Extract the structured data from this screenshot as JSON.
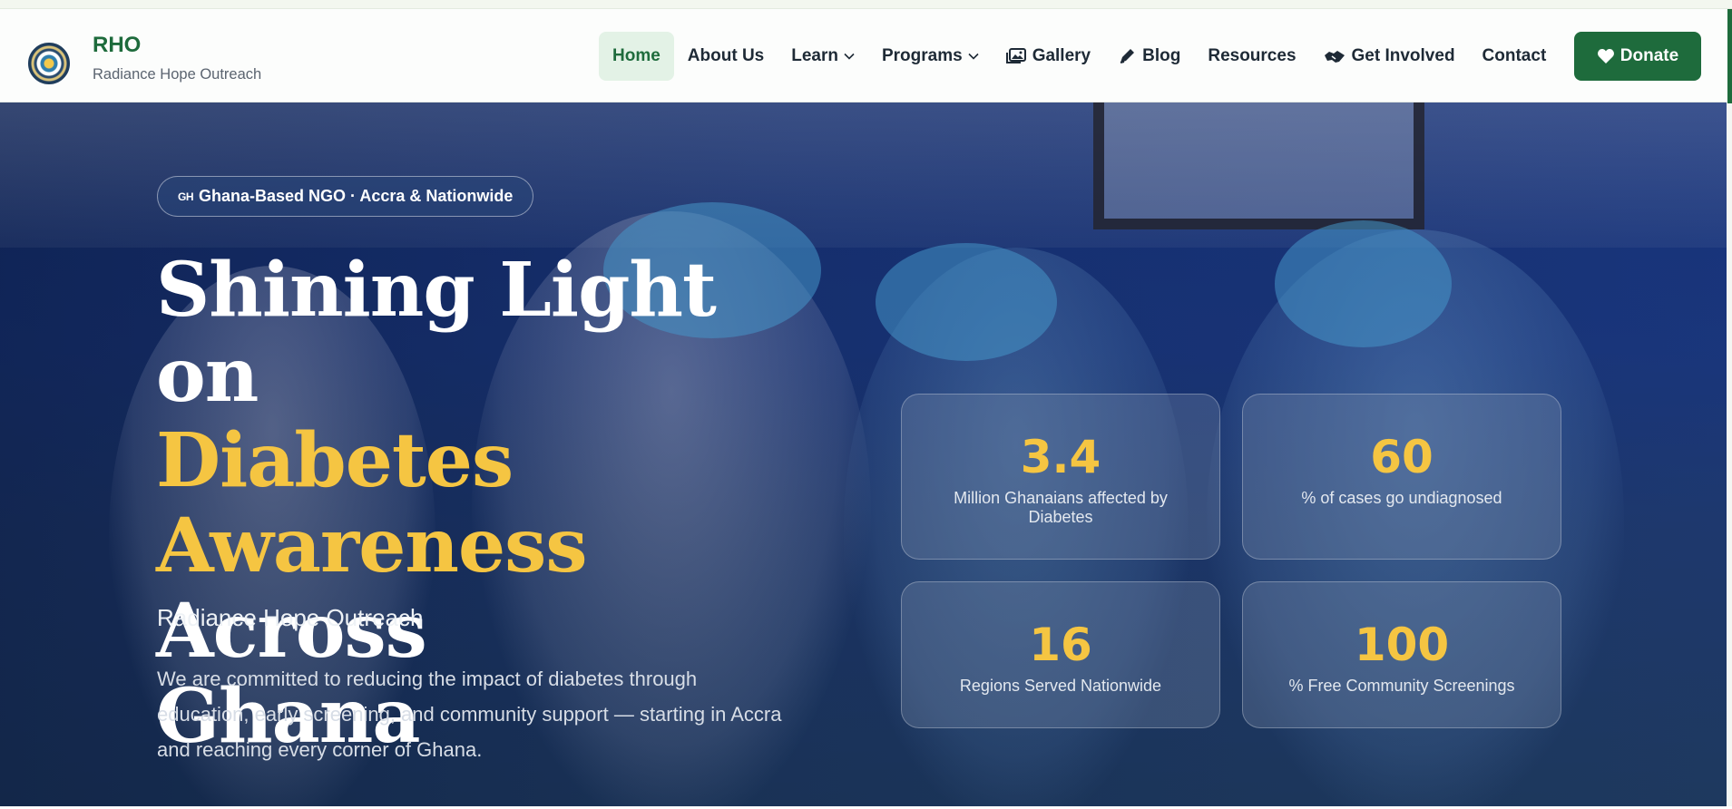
{
  "brand": {
    "title": "RHO",
    "subtitle": "Radiance Hope Outreach"
  },
  "nav": {
    "items": [
      {
        "label": "Home",
        "active": true,
        "icon": null,
        "dropdown": false
      },
      {
        "label": "About Us",
        "active": false,
        "icon": null,
        "dropdown": false
      },
      {
        "label": "Learn",
        "active": false,
        "icon": null,
        "dropdown": true
      },
      {
        "label": "Programs",
        "active": false,
        "icon": null,
        "dropdown": true
      },
      {
        "label": "Gallery",
        "active": false,
        "icon": "images-icon",
        "dropdown": false
      },
      {
        "label": "Blog",
        "active": false,
        "icon": "pen-icon",
        "dropdown": false
      },
      {
        "label": "Resources",
        "active": false,
        "icon": null,
        "dropdown": false
      },
      {
        "label": "Get Involved",
        "active": false,
        "icon": "handshake-icon",
        "dropdown": false
      },
      {
        "label": "Contact",
        "active": false,
        "icon": null,
        "dropdown": false
      }
    ],
    "donate_label": "Donate",
    "donate_icon": "heart-icon"
  },
  "hero": {
    "badge_flag": "GH",
    "badge_text": "Ghana-Based NGO · Accra & Nationwide",
    "headline": {
      "part1": "Shining Light on",
      "highlight1": "Diabetes",
      "highlight2": "Awareness",
      "part2": "Across",
      "part3": "Ghana"
    },
    "subtitle": "Radiance Hope Outreach",
    "description": "We are committed to reducing the impact of diabetes through education, early screening, and community support — starting in Accra and reaching every corner of Ghana."
  },
  "stats": [
    {
      "value": "3.4",
      "label": "Million Ghanaians affected by Diabetes"
    },
    {
      "value": "60",
      "label": "% of cases go undiagnosed"
    },
    {
      "value": "16",
      "label": "Regions Served Nationwide"
    },
    {
      "value": "100",
      "label": "% Free Community Screenings"
    }
  ],
  "colors": {
    "brand_green": "#1e6b3c",
    "accent_gold": "#f5c542",
    "active_nav_bg": "#e3f2e6"
  }
}
